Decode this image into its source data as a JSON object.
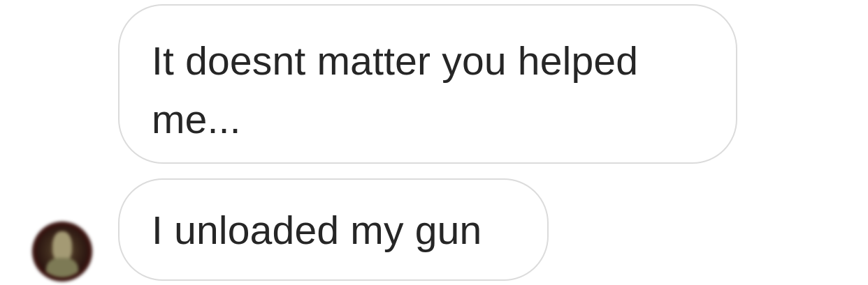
{
  "thread": {
    "messages": [
      {
        "text": "It doesnt matter you helped me..."
      },
      {
        "text": "I unloaded my gun"
      }
    ],
    "avatar_icon": "user-avatar-icon",
    "colors": {
      "bubble_border": "#dbdbdb",
      "bubble_text": "#262626",
      "background": "#ffffff"
    }
  }
}
